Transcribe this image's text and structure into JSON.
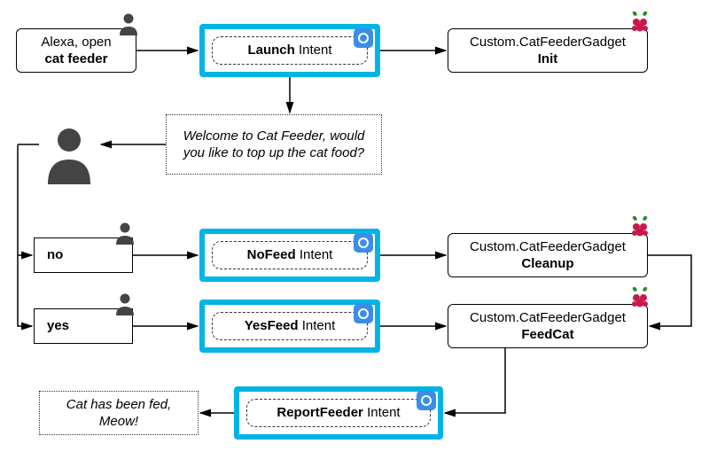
{
  "diagram": {
    "open_utterance_prefix": "Alexa, open",
    "open_utterance_bold": "cat feeder",
    "launch_bold": "Launch",
    "launch_rest": " Intent",
    "init_ns": "Custom.CatFeederGadget",
    "init_bold": "Init",
    "welcome_msg": "Welcome to Cat Feeder, would you like to top up the cat food?",
    "no_bold": "no",
    "yes_bold": "yes",
    "nofeed_bold": "NoFeed",
    "nofeed_rest": " Intent",
    "yesfeed_bold": "YesFeed",
    "yesfeed_rest": " Intent",
    "cleanup_ns": "Custom.CatFeederGadget",
    "cleanup_bold": "Cleanup",
    "feedcat_ns": "Custom.CatFeederGadget",
    "feedcat_bold": "FeedCat",
    "report_bold": "ReportFeeder",
    "report_rest": " Intent",
    "fed_msg": "Cat has been fed, Meow!"
  }
}
